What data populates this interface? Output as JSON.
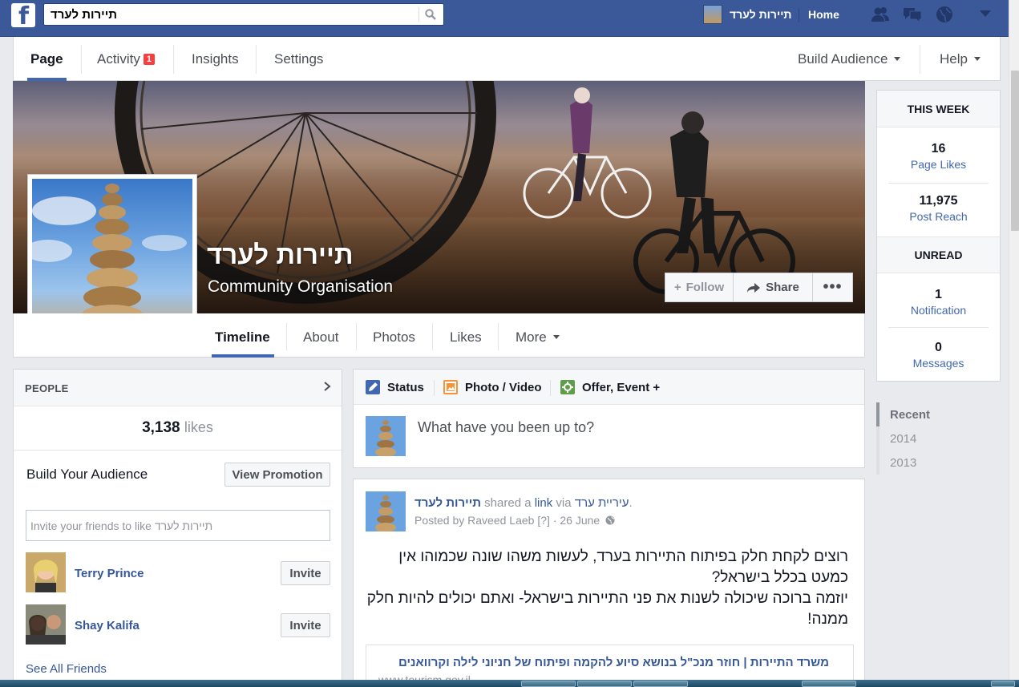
{
  "topbar": {
    "search_value": "תיירות לערד",
    "page_name": "תיירות לערד",
    "home": "Home"
  },
  "admin": {
    "tabs": [
      "Page",
      "Activity",
      "Insights",
      "Settings"
    ],
    "activity_badge": "1",
    "build_audience": "Build Audience",
    "help": "Help"
  },
  "cover": {
    "title": "תיירות לערד",
    "subtitle": "Community Organisation",
    "follow": "Follow",
    "share": "Share",
    "more": "•••"
  },
  "timeline_nav": {
    "tabs": [
      "Timeline",
      "About",
      "Photos",
      "Likes",
      "More"
    ]
  },
  "this_week": {
    "heading": "THIS WEEK",
    "page_likes_num": "16",
    "page_likes_label": "Page Likes",
    "post_reach_num": "11,975",
    "post_reach_label": "Post Reach",
    "unread_heading": "UNREAD",
    "notification_num": "1",
    "notification_label": "Notification",
    "messages_num": "0",
    "messages_label": "Messages"
  },
  "years": [
    "Recent",
    "2014",
    "2013"
  ],
  "people": {
    "heading": "PEOPLE",
    "likes_count": "3,138",
    "likes_word": "likes",
    "build_audience": "Build Your Audience",
    "view_promotion": "View Promotion",
    "invite_placeholder": "Invite your friends to like תיירות לערד",
    "friends": [
      {
        "name": "Terry Prince",
        "action": "Invite"
      },
      {
        "name": "Shay Kalifa",
        "action": "Invite"
      }
    ],
    "see_all": "See All Friends"
  },
  "composer": {
    "status": "Status",
    "photo_video": "Photo / Video",
    "offer_event": "Offer, Event +",
    "placeholder": "What have you been up to?"
  },
  "post": {
    "author": "תיירות לערד",
    "shared_a": "shared a",
    "link_word": "link",
    "via": "via",
    "via_page": "עיריית ערד",
    "period": ".",
    "posted_by": "Posted by",
    "poster": "Raveed Laeb",
    "help_mark": "[?]",
    "dot": "·",
    "date": "26 June",
    "body_line1": "רוצים לקחת חלק בפיתוח התיירות בערד, לעשות משהו שונה שכמוהו אין כמעט בכלל בישראל?",
    "body_line2": "יוזמה ברוכה שיכולה לשנות את פני התיירות בישראל- ואתם יכולים להיות חלק ממנה!",
    "link_title": "משרד התיירות | חוזר מנכ\"ל בנושא סיוע להקמה ופיתוח של חניוני לילה וקרוואנים",
    "link_url": "www.tourism.gov.il"
  },
  "colors": {
    "facebook_blue": "#3b5998",
    "link_blue": "#365899",
    "badge_red": "#fa3e3e"
  }
}
